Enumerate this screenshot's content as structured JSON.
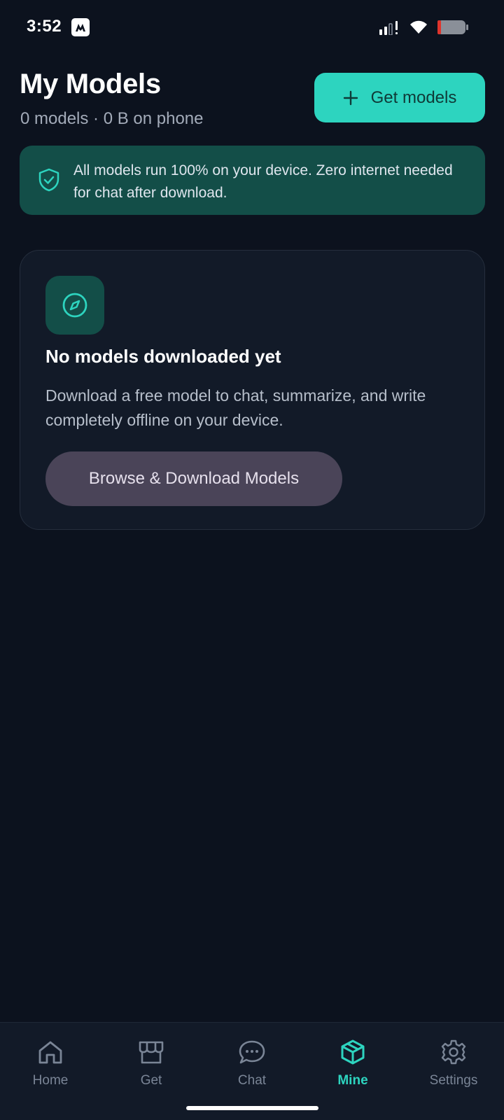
{
  "status_bar": {
    "time": "3:52"
  },
  "header": {
    "title": "My Models",
    "subtitle": "0 models · 0 B on phone",
    "get_models_label": "Get models"
  },
  "privacy_banner": {
    "text": "All models run 100% on your device. Zero internet needed for chat after download."
  },
  "empty_state": {
    "title": "No models downloaded yet",
    "description": "Download a free model to chat, summarize, and write completely offline on your device.",
    "button_label": "Browse & Download Models"
  },
  "bottom_nav": {
    "items": [
      {
        "label": "Home",
        "icon": "home-icon",
        "active": false
      },
      {
        "label": "Get",
        "icon": "store-icon",
        "active": false
      },
      {
        "label": "Chat",
        "icon": "chat-bubble-icon",
        "active": false
      },
      {
        "label": "Mine",
        "icon": "cube-icon",
        "active": true
      },
      {
        "label": "Settings",
        "icon": "gear-icon",
        "active": false
      }
    ]
  },
  "colors": {
    "background": "#0c121e",
    "accent": "#2dd4bf",
    "banner": "#134e48",
    "card": "#121a28",
    "secondary_button": "#4a4458",
    "inactive_nav": "#7a8596"
  }
}
